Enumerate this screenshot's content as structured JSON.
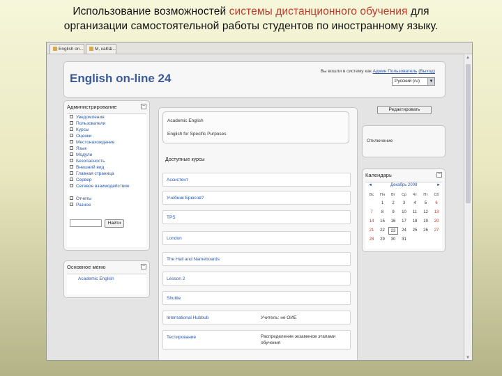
{
  "slide": {
    "title_part1": "Использование возможностей ",
    "title_accent": "системы дистанционного обучения",
    "title_part2": " для",
    "title_line2": "организации самостоятельной работы студентов по иностранному языку."
  },
  "browser": {
    "tabs": [
      "English on...",
      "М, каКШ..."
    ]
  },
  "header": {
    "site_name": "English on-line 24",
    "login_prefix": "Вы вошли в систему как ",
    "login_user": "Админ Пользователь",
    "login_exit": "(Выход)",
    "language": "Русский (ru)"
  },
  "admin_block": {
    "title": "Администрирование",
    "items": [
      "Уведомления",
      "Пользователи",
      "Курсы",
      "Оценки",
      "Местонахождение",
      "Язык",
      "Модули",
      "Безопасность",
      "Внешний вид",
      "Главная страница",
      "Сервер",
      "Сетевое взаимодействие",
      "Отчеты",
      "Разное"
    ],
    "search_button": "Найти"
  },
  "main_menu": {
    "title": "Основное меню",
    "items": [
      "Academic English"
    ]
  },
  "top_box": {
    "items": [
      "Academic English",
      "English for Specific Purposes"
    ]
  },
  "edit_button": "Редактировать",
  "right_box": {
    "text": "Отключение"
  },
  "courses": {
    "title": "Доступные курсы",
    "rows": [
      {
        "name": "Ассистент",
        "teacher": ""
      },
      {
        "name": "Учебник Брюсов?",
        "teacher": ""
      },
      {
        "name": "TPS",
        "teacher": ""
      },
      {
        "name": "London",
        "teacher": ""
      },
      {
        "name": "The Hall and Nameboards",
        "teacher": ""
      },
      {
        "name": "Lesson 2",
        "teacher": ""
      },
      {
        "name": "Shuttle",
        "teacher": ""
      },
      {
        "name": "International Hubbub",
        "teacher": "Учитель: не ОИЕ"
      },
      {
        "name": "Тестирование",
        "teacher": "Распределение экзаменов этапами обучения"
      }
    ]
  },
  "calendar": {
    "title": "Календарь",
    "month": "Декабрь 2008",
    "prev": "◄",
    "next": "►",
    "weekdays": [
      "Вс",
      "Пн",
      "Вт",
      "Ср",
      "Чт",
      "Пт",
      "Сб"
    ],
    "weeks": [
      [
        "",
        "1",
        "2",
        "3",
        "4",
        "5",
        "6"
      ],
      [
        "7",
        "8",
        "9",
        "10",
        "11",
        "12",
        "13"
      ],
      [
        "14",
        "15",
        "16",
        "17",
        "18",
        "19",
        "20"
      ],
      [
        "21",
        "22",
        "23",
        "24",
        "25",
        "26",
        "27"
      ],
      [
        "28",
        "29",
        "30",
        "31",
        "",
        "",
        ""
      ]
    ],
    "today": "23"
  }
}
